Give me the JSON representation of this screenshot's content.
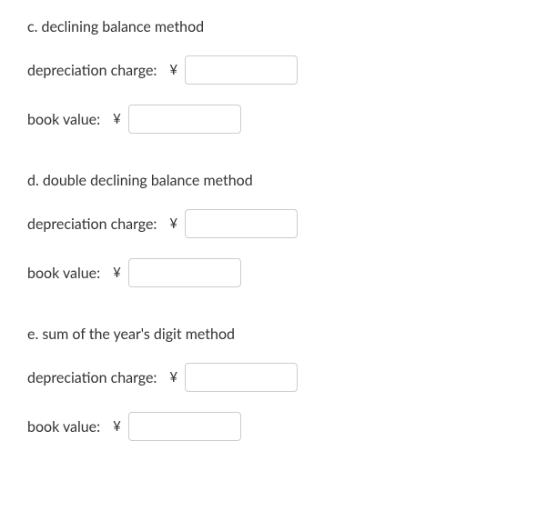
{
  "currency_symbol": "¥",
  "sections": [
    {
      "title": "c. declining balance method",
      "fields": [
        {
          "label": "depreciation charge:",
          "value": ""
        },
        {
          "label": "book value:",
          "value": ""
        }
      ]
    },
    {
      "title": "d. double declining balance method",
      "fields": [
        {
          "label": "depreciation charge:",
          "value": ""
        },
        {
          "label": "book value:",
          "value": ""
        }
      ]
    },
    {
      "title": "e. sum of the year's digit method",
      "fields": [
        {
          "label": "depreciation charge:",
          "value": ""
        },
        {
          "label": "book value:",
          "value": ""
        }
      ]
    }
  ]
}
